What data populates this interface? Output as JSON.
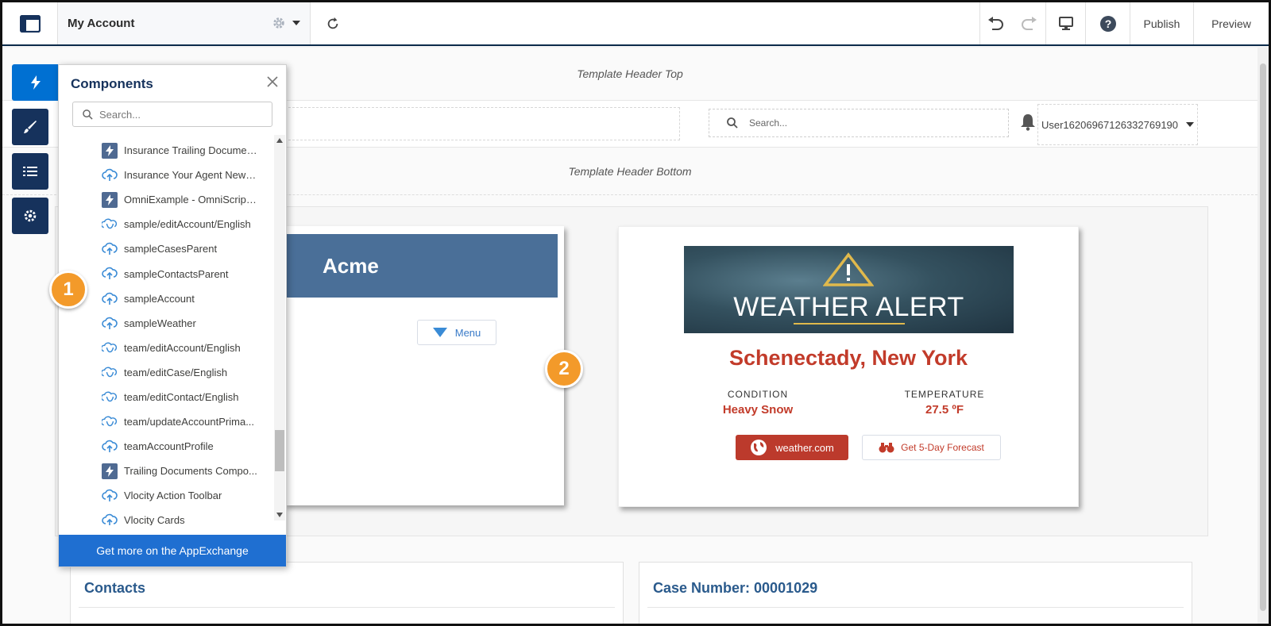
{
  "topbar": {
    "page_name": "My Account",
    "publish_label": "Publish",
    "preview_label": "Preview"
  },
  "canvas": {
    "header_top_label": "Template Header Top",
    "header_bottom_label": "Template Header Bottom",
    "search_placeholder": "Search...",
    "user_name": "User16206967126332769190"
  },
  "acme": {
    "title": "Acme",
    "menu_label": "Menu"
  },
  "weather": {
    "banner_title": "WEATHER ALERT",
    "city": "Schenectady, New York",
    "condition_label": "CONDITION",
    "condition_value": "Heavy Snow",
    "temperature_label": "TEMPERATURE",
    "temperature_value": "27.5 ºF",
    "weather_button": "weather.com",
    "forecast_button": "Get 5-Day Forecast"
  },
  "cards": {
    "contacts_title": "Contacts",
    "case_title": "Case Number: 00001029"
  },
  "callouts": {
    "one": "1",
    "two": "2"
  },
  "panel": {
    "title": "Components",
    "search_placeholder": "Search...",
    "appexchange_label": "Get more on the AppExchange",
    "items": [
      {
        "label": "Insurance Trailing Documen...",
        "icon": "lightning-icon"
      },
      {
        "label": "Insurance Your Agent Newp...",
        "icon": "cloud-icon"
      },
      {
        "label": "OmniExample - OmniScript ...",
        "icon": "lightning-icon"
      },
      {
        "label": "sample/editAccount/English",
        "icon": "omni-icon"
      },
      {
        "label": "sampleCasesParent",
        "icon": "cloud-icon"
      },
      {
        "label": "sampleContactsParent",
        "icon": "cloud-icon"
      },
      {
        "label": "sampleAccount",
        "icon": "cloud-icon"
      },
      {
        "label": "sampleWeather",
        "icon": "cloud-icon"
      },
      {
        "label": "team/editAccount/English",
        "icon": "omni-icon"
      },
      {
        "label": "team/editCase/English",
        "icon": "omni-icon"
      },
      {
        "label": "team/editContact/English",
        "icon": "omni-icon"
      },
      {
        "label": "team/updateAccountPrima...",
        "icon": "omni-icon"
      },
      {
        "label": "teamAccountProfile",
        "icon": "cloud-icon"
      },
      {
        "label": "Trailing Documents Compo...",
        "icon": "lightning-icon"
      },
      {
        "label": "Vlocity Action Toolbar",
        "icon": "cloud-icon"
      },
      {
        "label": "Vlocity Cards",
        "icon": "cloud-icon"
      }
    ]
  },
  "colors": {
    "navy": "#16325c",
    "brand_blue": "#0070d2",
    "alert_red": "#c23b2a",
    "callout_orange": "#f39a2a"
  }
}
